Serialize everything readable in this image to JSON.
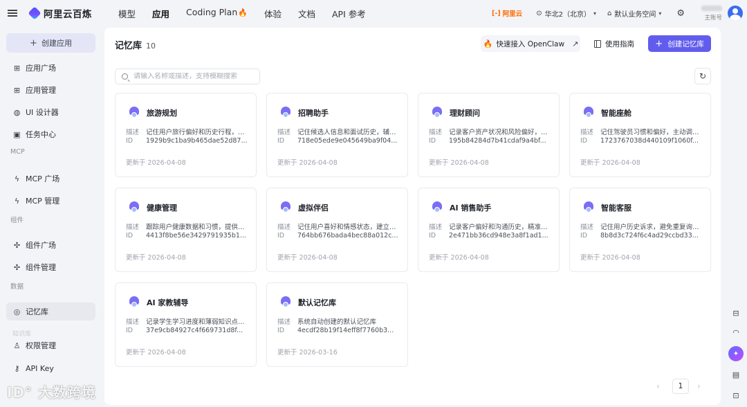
{
  "brand": {
    "name": "阿里云百炼"
  },
  "topnav": [
    {
      "label": "模型",
      "active": false
    },
    {
      "label": "应用",
      "active": true
    },
    {
      "label": "Coding Plan",
      "active": false,
      "fire": true
    },
    {
      "label": "体验",
      "active": false
    },
    {
      "label": "文档",
      "active": false
    },
    {
      "label": "API 参考",
      "active": false
    }
  ],
  "topright": {
    "aliyun_badge": "阿里云",
    "region": "华北2（北京）",
    "workspace": "默认业务空间",
    "user_sub": "主账号"
  },
  "sidebar": {
    "create_label": "创建应用",
    "sections": [
      {
        "group": "",
        "items": [
          {
            "label": "应用广场",
            "icon": "grid-icon"
          },
          {
            "label": "应用管理",
            "icon": "apps-icon"
          },
          {
            "label": "UI 设计器",
            "icon": "palette-icon"
          },
          {
            "label": "任务中心",
            "icon": "task-icon"
          }
        ]
      },
      {
        "group": "MCP",
        "items": [
          {
            "label": "MCP 广场",
            "icon": "bolt-icon"
          },
          {
            "label": "MCP 管理",
            "icon": "mcp-manage-icon"
          }
        ]
      },
      {
        "group": "组件",
        "items": [
          {
            "label": "组件广场",
            "icon": "puzzle-icon"
          },
          {
            "label": "组件管理",
            "icon": "component-manage-icon"
          }
        ]
      },
      {
        "group": "数据",
        "items": [
          {
            "label": "记忆库",
            "icon": "memory-icon",
            "active": true
          }
        ]
      }
    ],
    "faded_label": "知识库",
    "bottom_items": [
      {
        "label": "权限管理",
        "icon": "user-icon"
      },
      {
        "label": "API Key",
        "icon": "key-icon"
      }
    ]
  },
  "page": {
    "title": "记忆库",
    "count": "10",
    "openclaw_label": "快速接入 OpenClaw",
    "guide_label": "使用指南",
    "create_label": "创建记忆库",
    "search_placeholder": "请输入名称或描述，支持模糊搜索"
  },
  "card_labels": {
    "desc": "描述",
    "id": "ID",
    "updated_prefix": "更新于"
  },
  "cards": [
    {
      "name": "旅游规划",
      "desc": "记住用户旅行偏好和历史行程，推...",
      "id": "1929b9c1ba9b465dae52d87...",
      "updated": "2026-04-08"
    },
    {
      "name": "招聘助手",
      "desc": "记住候选人信息和面试历史，辅助...",
      "id": "718e05ede9e045649ba9f04...",
      "updated": "2026-04-08"
    },
    {
      "name": "理财顾问",
      "desc": "记录客户资产状况和风险偏好，定...",
      "id": "195b84284d7b41cdaf9a4bf...",
      "updated": "2026-04-08"
    },
    {
      "name": "智能座舱",
      "desc": "记住驾驶员习惯和偏好，主动调节...",
      "id": "1723767038d440109f1060f...",
      "updated": "2026-04-08"
    },
    {
      "name": "健康管理",
      "desc": "跟踪用户健康数据和习惯，提供个...",
      "id": "4413f8be56e3429791935b1...",
      "updated": "2026-04-08"
    },
    {
      "name": "虚拟伴侣",
      "desc": "记住用户喜好和情感状态，建立长...",
      "id": "764bb676bada4bec88a012c...",
      "updated": "2026-04-08"
    },
    {
      "name": "AI 销售助手",
      "desc": "记录客户偏好和沟通历史，精准推...",
      "id": "2e471bb36cd948e3a8f1ad1...",
      "updated": "2026-04-08"
    },
    {
      "name": "智能客服",
      "desc": "记住用户历史诉求，避免重复询问...",
      "id": "8b8d3c724f6c4ad29ccbd33...",
      "updated": "2026-04-08"
    },
    {
      "name": "AI 家教辅导",
      "desc": "记录学生学习进度和薄弱知识点，...",
      "id": "37e9cb84927c4f669731d8f...",
      "updated": "2026-04-08"
    },
    {
      "name": "默认记忆库",
      "desc": "系统自动创建的默认记忆库",
      "id": "4ecdf28b19f14eff8f7760b3...",
      "updated": "2026-03-16"
    }
  ],
  "pagination": {
    "current": "1"
  },
  "watermark": "大数跨境",
  "colors": {
    "primary": "#615ced",
    "aliyun_orange": "#ff6a00",
    "avatar_blue": "#3a6df0"
  }
}
